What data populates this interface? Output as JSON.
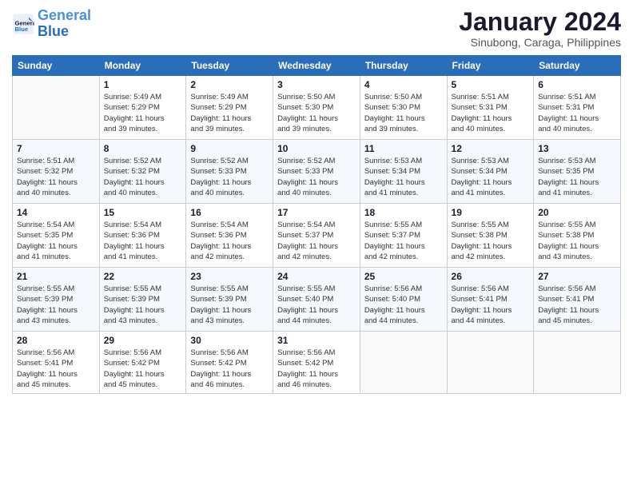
{
  "logo": {
    "text_general": "General",
    "text_blue": "Blue"
  },
  "header": {
    "title": "January 2024",
    "subtitle": "Sinubong, Caraga, Philippines"
  },
  "days_of_week": [
    "Sunday",
    "Monday",
    "Tuesday",
    "Wednesday",
    "Thursday",
    "Friday",
    "Saturday"
  ],
  "weeks": [
    [
      {
        "day": "",
        "info": ""
      },
      {
        "day": "1",
        "info": "Sunrise: 5:49 AM\nSunset: 5:29 PM\nDaylight: 11 hours\nand 39 minutes."
      },
      {
        "day": "2",
        "info": "Sunrise: 5:49 AM\nSunset: 5:29 PM\nDaylight: 11 hours\nand 39 minutes."
      },
      {
        "day": "3",
        "info": "Sunrise: 5:50 AM\nSunset: 5:30 PM\nDaylight: 11 hours\nand 39 minutes."
      },
      {
        "day": "4",
        "info": "Sunrise: 5:50 AM\nSunset: 5:30 PM\nDaylight: 11 hours\nand 39 minutes."
      },
      {
        "day": "5",
        "info": "Sunrise: 5:51 AM\nSunset: 5:31 PM\nDaylight: 11 hours\nand 40 minutes."
      },
      {
        "day": "6",
        "info": "Sunrise: 5:51 AM\nSunset: 5:31 PM\nDaylight: 11 hours\nand 40 minutes."
      }
    ],
    [
      {
        "day": "7",
        "info": "Sunrise: 5:51 AM\nSunset: 5:32 PM\nDaylight: 11 hours\nand 40 minutes."
      },
      {
        "day": "8",
        "info": "Sunrise: 5:52 AM\nSunset: 5:32 PM\nDaylight: 11 hours\nand 40 minutes."
      },
      {
        "day": "9",
        "info": "Sunrise: 5:52 AM\nSunset: 5:33 PM\nDaylight: 11 hours\nand 40 minutes."
      },
      {
        "day": "10",
        "info": "Sunrise: 5:52 AM\nSunset: 5:33 PM\nDaylight: 11 hours\nand 40 minutes."
      },
      {
        "day": "11",
        "info": "Sunrise: 5:53 AM\nSunset: 5:34 PM\nDaylight: 11 hours\nand 41 minutes."
      },
      {
        "day": "12",
        "info": "Sunrise: 5:53 AM\nSunset: 5:34 PM\nDaylight: 11 hours\nand 41 minutes."
      },
      {
        "day": "13",
        "info": "Sunrise: 5:53 AM\nSunset: 5:35 PM\nDaylight: 11 hours\nand 41 minutes."
      }
    ],
    [
      {
        "day": "14",
        "info": "Sunrise: 5:54 AM\nSunset: 5:35 PM\nDaylight: 11 hours\nand 41 minutes."
      },
      {
        "day": "15",
        "info": "Sunrise: 5:54 AM\nSunset: 5:36 PM\nDaylight: 11 hours\nand 41 minutes."
      },
      {
        "day": "16",
        "info": "Sunrise: 5:54 AM\nSunset: 5:36 PM\nDaylight: 11 hours\nand 42 minutes."
      },
      {
        "day": "17",
        "info": "Sunrise: 5:54 AM\nSunset: 5:37 PM\nDaylight: 11 hours\nand 42 minutes."
      },
      {
        "day": "18",
        "info": "Sunrise: 5:55 AM\nSunset: 5:37 PM\nDaylight: 11 hours\nand 42 minutes."
      },
      {
        "day": "19",
        "info": "Sunrise: 5:55 AM\nSunset: 5:38 PM\nDaylight: 11 hours\nand 42 minutes."
      },
      {
        "day": "20",
        "info": "Sunrise: 5:55 AM\nSunset: 5:38 PM\nDaylight: 11 hours\nand 43 minutes."
      }
    ],
    [
      {
        "day": "21",
        "info": "Sunrise: 5:55 AM\nSunset: 5:39 PM\nDaylight: 11 hours\nand 43 minutes."
      },
      {
        "day": "22",
        "info": "Sunrise: 5:55 AM\nSunset: 5:39 PM\nDaylight: 11 hours\nand 43 minutes."
      },
      {
        "day": "23",
        "info": "Sunrise: 5:55 AM\nSunset: 5:39 PM\nDaylight: 11 hours\nand 43 minutes."
      },
      {
        "day": "24",
        "info": "Sunrise: 5:55 AM\nSunset: 5:40 PM\nDaylight: 11 hours\nand 44 minutes."
      },
      {
        "day": "25",
        "info": "Sunrise: 5:56 AM\nSunset: 5:40 PM\nDaylight: 11 hours\nand 44 minutes."
      },
      {
        "day": "26",
        "info": "Sunrise: 5:56 AM\nSunset: 5:41 PM\nDaylight: 11 hours\nand 44 minutes."
      },
      {
        "day": "27",
        "info": "Sunrise: 5:56 AM\nSunset: 5:41 PM\nDaylight: 11 hours\nand 45 minutes."
      }
    ],
    [
      {
        "day": "28",
        "info": "Sunrise: 5:56 AM\nSunset: 5:41 PM\nDaylight: 11 hours\nand 45 minutes."
      },
      {
        "day": "29",
        "info": "Sunrise: 5:56 AM\nSunset: 5:42 PM\nDaylight: 11 hours\nand 45 minutes."
      },
      {
        "day": "30",
        "info": "Sunrise: 5:56 AM\nSunset: 5:42 PM\nDaylight: 11 hours\nand 46 minutes."
      },
      {
        "day": "31",
        "info": "Sunrise: 5:56 AM\nSunset: 5:42 PM\nDaylight: 11 hours\nand 46 minutes."
      },
      {
        "day": "",
        "info": ""
      },
      {
        "day": "",
        "info": ""
      },
      {
        "day": "",
        "info": ""
      }
    ]
  ]
}
